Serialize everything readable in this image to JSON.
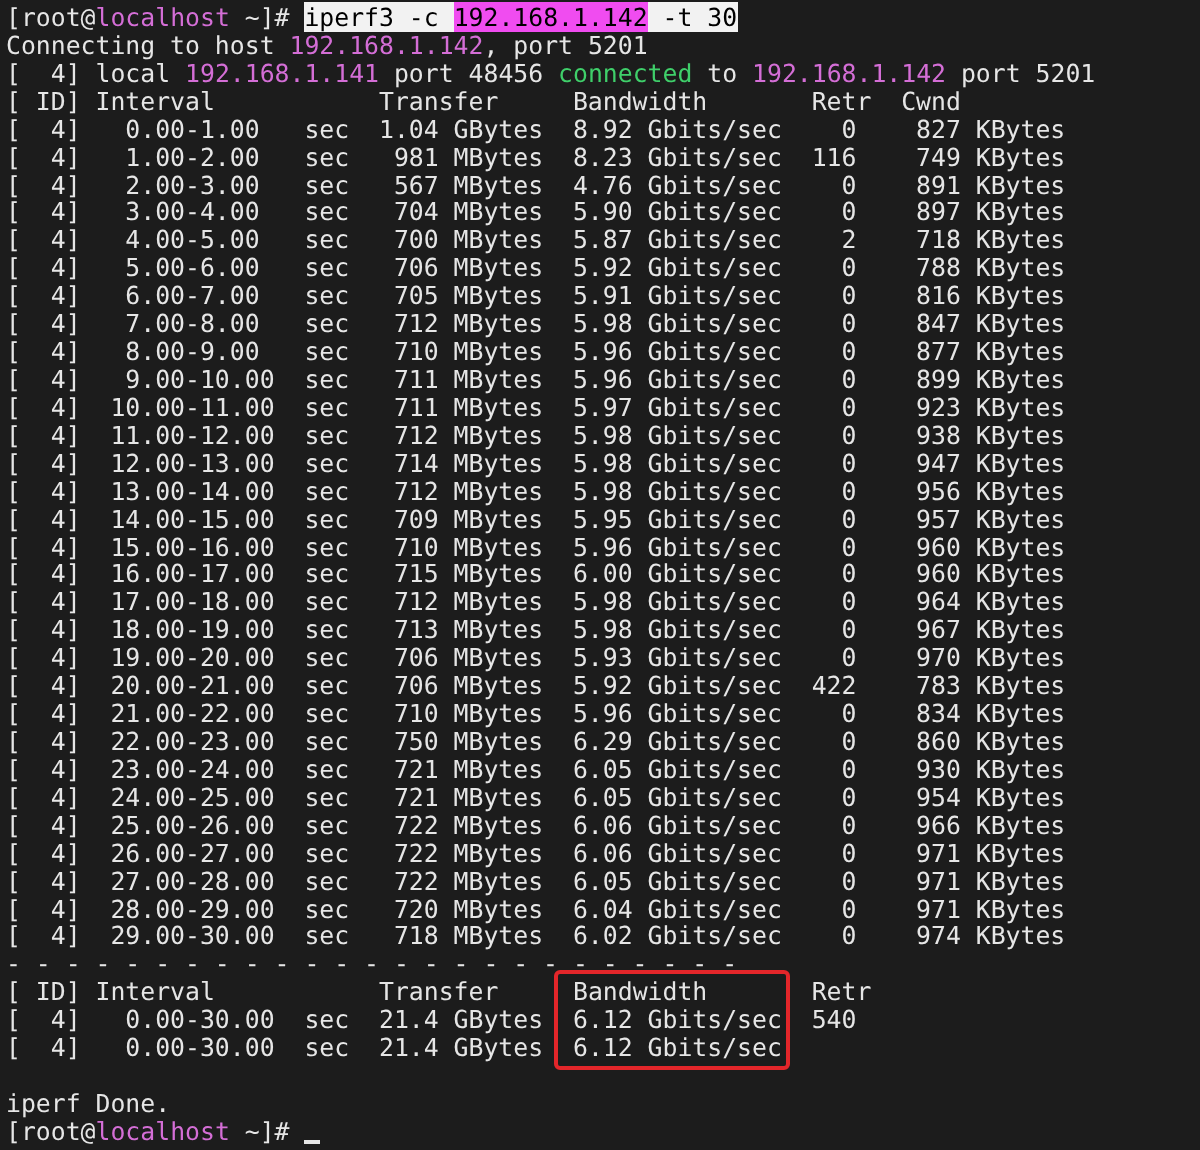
{
  "terminal": {
    "lines": [
      {
        "segments": [
          {
            "text": "[root@",
            "kind": "plain"
          },
          {
            "text": "localhost",
            "kind": "magenta"
          },
          {
            "text": " ~]# ",
            "kind": "plain"
          },
          {
            "text": "iperf3 -c ",
            "kind": "selected"
          },
          {
            "text": "192.168.1.142",
            "kind": "selected-magenta"
          },
          {
            "text": " -t 30",
            "kind": "selected"
          }
        ]
      },
      {
        "segments": [
          {
            "text": "Connecting to host ",
            "kind": "plain"
          },
          {
            "text": "192.168.1.142",
            "kind": "magenta"
          },
          {
            "text": ", port 5201",
            "kind": "plain"
          }
        ]
      },
      {
        "segments": [
          {
            "text": "[  4] local ",
            "kind": "plain"
          },
          {
            "text": "192.168.1.141",
            "kind": "magenta"
          },
          {
            "text": " port 48456 ",
            "kind": "plain"
          },
          {
            "text": "connected",
            "kind": "green"
          },
          {
            "text": " to ",
            "kind": "plain"
          },
          {
            "text": "192.168.1.142",
            "kind": "magenta"
          },
          {
            "text": " port 5201",
            "kind": "plain"
          }
        ]
      },
      {
        "text": "[ ID] Interval           Transfer     Bandwidth       Retr  Cwnd"
      },
      {
        "text": "[  4]   0.00-1.00   sec  1.04 GBytes  8.92 Gbits/sec    0    827 KBytes"
      },
      {
        "text": "[  4]   1.00-2.00   sec   981 MBytes  8.23 Gbits/sec  116    749 KBytes"
      },
      {
        "text": "[  4]   2.00-3.00   sec   567 MBytes  4.76 Gbits/sec    0    891 KBytes"
      },
      {
        "text": "[  4]   3.00-4.00   sec   704 MBytes  5.90 Gbits/sec    0    897 KBytes"
      },
      {
        "text": "[  4]   4.00-5.00   sec   700 MBytes  5.87 Gbits/sec    2    718 KBytes"
      },
      {
        "text": "[  4]   5.00-6.00   sec   706 MBytes  5.92 Gbits/sec    0    788 KBytes"
      },
      {
        "text": "[  4]   6.00-7.00   sec   705 MBytes  5.91 Gbits/sec    0    816 KBytes"
      },
      {
        "text": "[  4]   7.00-8.00   sec   712 MBytes  5.98 Gbits/sec    0    847 KBytes"
      },
      {
        "text": "[  4]   8.00-9.00   sec   710 MBytes  5.96 Gbits/sec    0    877 KBytes"
      },
      {
        "text": "[  4]   9.00-10.00  sec   711 MBytes  5.96 Gbits/sec    0    899 KBytes"
      },
      {
        "text": "[  4]  10.00-11.00  sec   711 MBytes  5.97 Gbits/sec    0    923 KBytes"
      },
      {
        "text": "[  4]  11.00-12.00  sec   712 MBytes  5.98 Gbits/sec    0    938 KBytes"
      },
      {
        "text": "[  4]  12.00-13.00  sec   714 MBytes  5.98 Gbits/sec    0    947 KBytes"
      },
      {
        "text": "[  4]  13.00-14.00  sec   712 MBytes  5.98 Gbits/sec    0    956 KBytes"
      },
      {
        "text": "[  4]  14.00-15.00  sec   709 MBytes  5.95 Gbits/sec    0    957 KBytes"
      },
      {
        "text": "[  4]  15.00-16.00  sec   710 MBytes  5.96 Gbits/sec    0    960 KBytes"
      },
      {
        "text": "[  4]  16.00-17.00  sec   715 MBytes  6.00 Gbits/sec    0    960 KBytes"
      },
      {
        "text": "[  4]  17.00-18.00  sec   712 MBytes  5.98 Gbits/sec    0    964 KBytes"
      },
      {
        "text": "[  4]  18.00-19.00  sec   713 MBytes  5.98 Gbits/sec    0    967 KBytes"
      },
      {
        "text": "[  4]  19.00-20.00  sec   706 MBytes  5.93 Gbits/sec    0    970 KBytes"
      },
      {
        "text": "[  4]  20.00-21.00  sec   706 MBytes  5.92 Gbits/sec  422    783 KBytes"
      },
      {
        "text": "[  4]  21.00-22.00  sec   710 MBytes  5.96 Gbits/sec    0    834 KBytes"
      },
      {
        "text": "[  4]  22.00-23.00  sec   750 MBytes  6.29 Gbits/sec    0    860 KBytes"
      },
      {
        "text": "[  4]  23.00-24.00  sec   721 MBytes  6.05 Gbits/sec    0    930 KBytes"
      },
      {
        "text": "[  4]  24.00-25.00  sec   721 MBytes  6.05 Gbits/sec    0    954 KBytes"
      },
      {
        "text": "[  4]  25.00-26.00  sec   722 MBytes  6.06 Gbits/sec    0    966 KBytes"
      },
      {
        "text": "[  4]  26.00-27.00  sec   722 MBytes  6.06 Gbits/sec    0    971 KBytes"
      },
      {
        "text": "[  4]  27.00-28.00  sec   722 MBytes  6.05 Gbits/sec    0    971 KBytes"
      },
      {
        "text": "[  4]  28.00-29.00  sec   720 MBytes  6.04 Gbits/sec    0    971 KBytes"
      },
      {
        "text": "[  4]  29.00-30.00  sec   718 MBytes  6.02 Gbits/sec    0    974 KBytes"
      },
      {
        "text": "- - - - - - - - - - - - - - - - - - - - - - - - -"
      },
      {
        "segments": [
          {
            "text": "[ ID] Interval           Transfer     ",
            "kind": "plain"
          },
          {
            "text": "Bandwidth",
            "kind": "plain",
            "boxed": true
          },
          {
            "text": "       Retr",
            "kind": "plain"
          }
        ]
      },
      {
        "segments": [
          {
            "text": "[  4]   0.00-30.00  sec  21.4 GBytes  ",
            "kind": "plain"
          },
          {
            "text": "6.12 Gbits/sec",
            "kind": "plain",
            "boxed": true
          },
          {
            "text": "  540",
            "kind": "plain"
          }
        ]
      },
      {
        "segments": [
          {
            "text": "[  4]   0.00-30.00  sec  21.4 GBytes  ",
            "kind": "plain"
          },
          {
            "text": "6.12 Gbits/sec",
            "kind": "plain",
            "boxed": true
          }
        ]
      },
      {
        "text": "iperf Done.",
        "gap_before": true
      },
      {
        "cursor": true,
        "segments": [
          {
            "text": "[root@",
            "kind": "plain"
          },
          {
            "text": "localhost",
            "kind": "magenta"
          },
          {
            "text": " ~]# ",
            "kind": "plain"
          }
        ]
      }
    ]
  }
}
